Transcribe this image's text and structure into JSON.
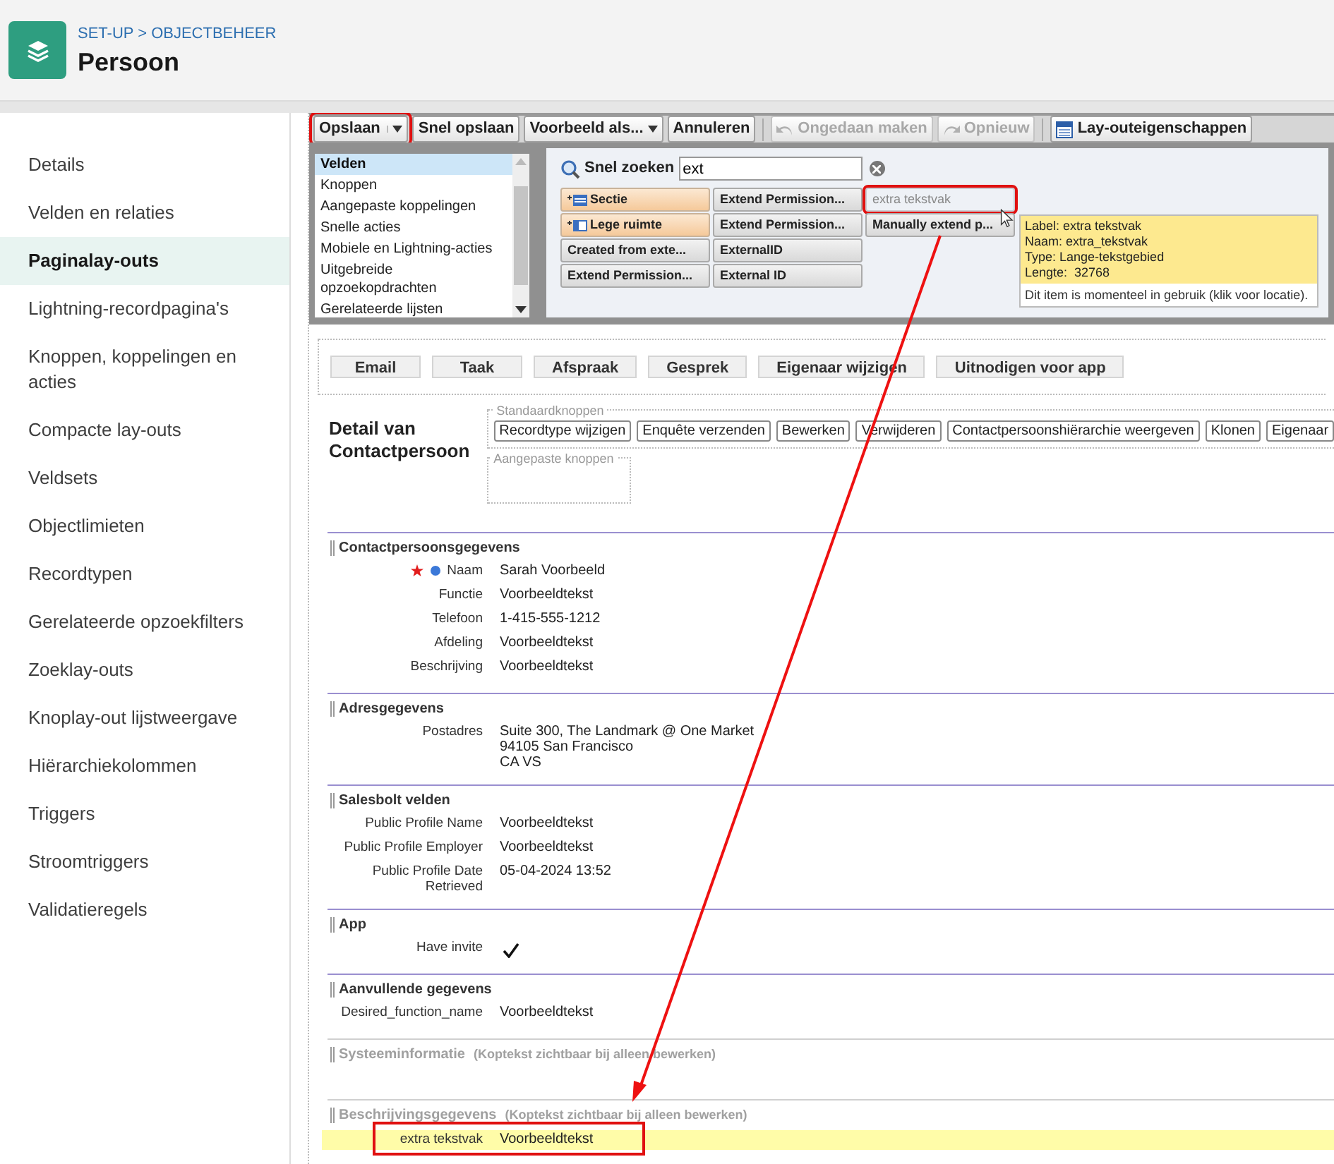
{
  "header": {
    "breadcrumb": "SET-UP > OBJECTBEHEER",
    "title": "Persoon"
  },
  "sidebar": {
    "items": [
      {
        "label": "Details",
        "selected": false
      },
      {
        "label": "Velden en relaties",
        "selected": false
      },
      {
        "label": "Paginalay-outs",
        "selected": true
      },
      {
        "label": "Lightning-recordpagina's",
        "selected": false
      },
      {
        "label": "Knoppen, koppelingen en acties",
        "selected": false
      },
      {
        "label": "Compacte lay-outs",
        "selected": false
      },
      {
        "label": "Veldsets",
        "selected": false
      },
      {
        "label": "Objectlimieten",
        "selected": false
      },
      {
        "label": "Recordtypen",
        "selected": false
      },
      {
        "label": "Gerelateerde opzoekfilters",
        "selected": false
      },
      {
        "label": "Zoeklay-outs",
        "selected": false
      },
      {
        "label": "Knoplay-out lijstweergave",
        "selected": false
      },
      {
        "label": "Hiërarchiekolommen",
        "selected": false
      },
      {
        "label": "Triggers",
        "selected": false
      },
      {
        "label": "Stroomtriggers",
        "selected": false
      },
      {
        "label": "Validatieregels",
        "selected": false
      }
    ]
  },
  "toolbar": [
    {
      "label": "Opslaan",
      "kind": "split",
      "disabled": false,
      "highlighted": true
    },
    {
      "label": "Snel opslaan",
      "kind": "button",
      "disabled": false,
      "highlighted": false
    },
    {
      "label": "Voorbeeld als...",
      "kind": "menu",
      "disabled": false,
      "highlighted": false
    },
    {
      "label": "Annuleren",
      "kind": "button",
      "disabled": false,
      "highlighted": false
    },
    {
      "label": "Ongedaan maken",
      "kind": "undo",
      "disabled": true,
      "highlighted": false
    },
    {
      "label": "Opnieuw",
      "kind": "redo",
      "disabled": true,
      "highlighted": false
    },
    {
      "label": "Lay-outeigenschappen",
      "kind": "props",
      "disabled": false,
      "highlighted": false
    }
  ],
  "palette": {
    "categories": [
      {
        "label": "Velden",
        "selected": true
      },
      {
        "label": "Knoppen",
        "selected": false
      },
      {
        "label": "Aangepaste koppelingen",
        "selected": false
      },
      {
        "label": "Snelle acties",
        "selected": false
      },
      {
        "label": "Mobiele en Lightning-acties",
        "selected": false
      },
      {
        "label": "Uitgebreide opzoekopdrachten",
        "selected": false
      },
      {
        "label": "Gerelateerde lijsten",
        "selected": false
      }
    ],
    "search": {
      "label": "Snel zoeken",
      "value": "ext"
    },
    "items": [
      {
        "label": "Sectie",
        "kind": "section",
        "highlighted": false
      },
      {
        "label": "Lege ruimte",
        "kind": "space",
        "highlighted": false
      },
      {
        "label": "Created from exte...",
        "kind": "field",
        "in_use": false,
        "highlighted": false
      },
      {
        "label": "Extend Permission...",
        "kind": "field",
        "in_use": false,
        "highlighted": false
      },
      {
        "label": "Extend Permission...",
        "kind": "field",
        "in_use": false,
        "highlighted": false
      },
      {
        "label": "Extend Permission...",
        "kind": "field",
        "in_use": false,
        "highlighted": false
      },
      {
        "label": "ExternalID",
        "kind": "field",
        "in_use": false,
        "highlighted": false
      },
      {
        "label": "External ID",
        "kind": "field",
        "in_use": false,
        "highlighted": false
      },
      {
        "label": "extra tekstvak",
        "kind": "field",
        "in_use": true,
        "highlighted": true
      },
      {
        "label": "Manually extend p...",
        "kind": "field",
        "in_use": false,
        "highlighted": false
      }
    ],
    "tooltip": {
      "lines": [
        "Label: extra tekstvak",
        "Naam: extra_tekstvak",
        "Type: Lange-tekstgebied",
        "Lengte:  32768"
      ],
      "note": "Dit item is momenteel in gebruik (klik voor locatie)."
    }
  },
  "quick_actions": [
    "Email",
    "Taak",
    "Afspraak",
    "Gesprek",
    "Eigenaar wijzigen",
    "Uitnodigen voor app"
  ],
  "detail": {
    "title": "Detail van Contactpersoon",
    "standard_label": "Standaardknoppen",
    "standard_buttons": [
      "Recordtype wijzigen",
      "Enquête verzenden",
      "Bewerken",
      "Verwijderen",
      "Contactpersoonshiërarchie weergeven",
      "Klonen",
      "Eigenaar"
    ],
    "custom_label": "Aangepaste knoppen"
  },
  "sections": [
    {
      "title": "Contactpersoonsgegevens",
      "muted": false,
      "fields": [
        {
          "label": "Naam",
          "value": "Sarah Voorbeeld",
          "kind": "text",
          "required": true,
          "highlighted": false
        },
        {
          "label": "Functie",
          "value": "Voorbeeldtekst",
          "kind": "text",
          "required": false,
          "highlighted": false
        },
        {
          "label": "Telefoon",
          "value": "1-415-555-1212",
          "kind": "text",
          "required": false,
          "highlighted": false
        },
        {
          "label": "Afdeling",
          "value": "Voorbeeldtekst",
          "kind": "text",
          "required": false,
          "highlighted": false
        },
        {
          "label": "Beschrijving",
          "value": "Voorbeeldtekst",
          "kind": "text",
          "required": false,
          "highlighted": false
        }
      ]
    },
    {
      "title": "Adresgegevens",
      "muted": false,
      "fields": [
        {
          "label": "Postadres",
          "lines": [
            "Suite 300, The Landmark @ One Market",
            "94105 San Francisco",
            "CA VS"
          ],
          "kind": "address",
          "required": false,
          "highlighted": false
        }
      ]
    },
    {
      "title": "Salesbolt velden",
      "muted": false,
      "fields": [
        {
          "label": "Public Profile Name",
          "value": "Voorbeeldtekst",
          "kind": "text",
          "required": false,
          "highlighted": false
        },
        {
          "label": "Public Profile Employer",
          "value": "Voorbeeldtekst",
          "kind": "text",
          "required": false,
          "highlighted": false
        },
        {
          "label": "Public Profile Date Retrieved",
          "value": "05-04-2024 13:52",
          "kind": "text",
          "required": false,
          "highlighted": false
        }
      ]
    },
    {
      "title": "App",
      "muted": false,
      "fields": [
        {
          "label": "Have invite",
          "checked": true,
          "kind": "check",
          "required": false,
          "highlighted": false
        }
      ]
    },
    {
      "title": "Aanvullende gegevens",
      "muted": false,
      "fields": [
        {
          "label": "Desired_function_name",
          "value": "Voorbeeldtekst",
          "kind": "text",
          "required": false,
          "highlighted": false
        }
      ]
    },
    {
      "title": "Systeeminformatie",
      "hint": "(Koptekst zichtbaar bij alleen bewerken)",
      "muted": true
    },
    {
      "title": "Beschrijvingsgegevens",
      "hint": "(Koptekst zichtbaar bij alleen bewerken)",
      "muted": true,
      "fields": [
        {
          "label": "extra tekstvak",
          "value": "Voorbeeldtekst",
          "kind": "text",
          "required": false,
          "highlighted": true
        }
      ]
    }
  ]
}
